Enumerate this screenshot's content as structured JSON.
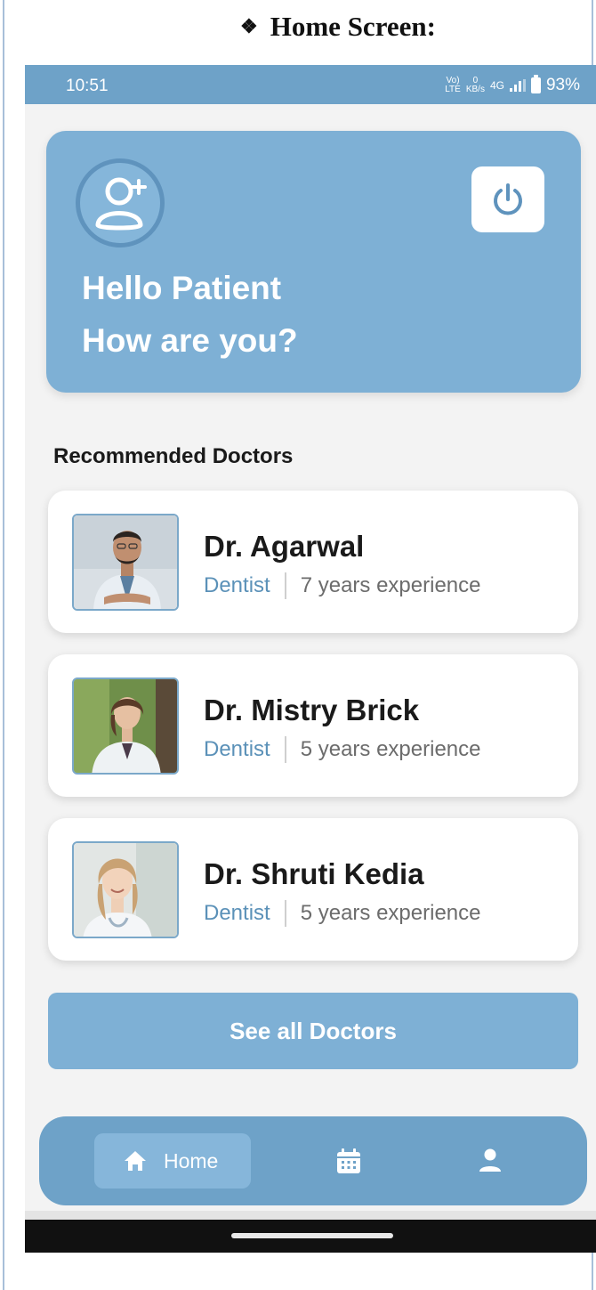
{
  "document": {
    "heading": "Home Screen:"
  },
  "status_bar": {
    "time": "10:51",
    "volte_top": "Vo)",
    "volte_bottom": "LTE",
    "speed_top": "0",
    "speed_bottom": "KB/s",
    "network": "4G",
    "battery": "93%"
  },
  "hero": {
    "greeting_line1": "Hello Patient",
    "greeting_line2": "How are you?",
    "avatar_icon": "user-add-icon",
    "power_icon": "power-icon"
  },
  "recommended": {
    "title": "Recommended Doctors",
    "doctors": [
      {
        "name": "Dr. Agarwal",
        "specialty": "Dentist",
        "experience": "7 years experience"
      },
      {
        "name": "Dr. Mistry Brick",
        "specialty": "Dentist",
        "experience": "5 years experience"
      },
      {
        "name": "Dr. Shruti Kedia",
        "specialty": "Dentist",
        "experience": "5 years experience"
      }
    ]
  },
  "see_all_label": "See all Doctors",
  "bottom_nav": {
    "items": [
      {
        "label": "Home",
        "icon": "home-icon",
        "active": true
      },
      {
        "label": "",
        "icon": "calendar-icon",
        "active": false
      },
      {
        "label": "",
        "icon": "person-icon",
        "active": false
      }
    ]
  },
  "colors": {
    "primary": "#7eb0d5",
    "status_bar": "#6ea2c8",
    "specialty_text": "#5b91b8"
  }
}
